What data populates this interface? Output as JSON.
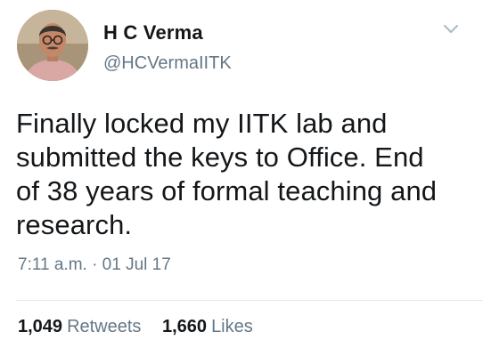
{
  "user": {
    "display_name": "H C Verma",
    "handle": "@HCVermaIITK"
  },
  "icons": {
    "avatar": "profile-photo",
    "menu": "chevron-down-icon"
  },
  "tweet": {
    "text": "Finally locked my  IITK lab and\nsubmitted the keys to Office. End\nof 38 years of formal teaching and\nresearch.",
    "timestamp": "7:11 a.m. · 01 Jul 17"
  },
  "stats": {
    "retweets_count": "1,049",
    "retweets_label": "Retweets",
    "likes_count": "1,660",
    "likes_label": "Likes"
  },
  "colors": {
    "primary_text": "#14171a",
    "secondary_text": "#657786",
    "divider": "#e1e8ed"
  }
}
